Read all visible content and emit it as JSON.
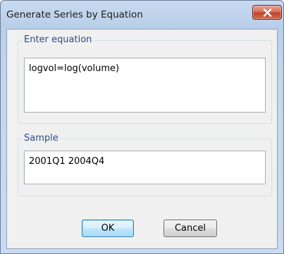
{
  "window": {
    "title": "Generate Series by Equation"
  },
  "equation_group": {
    "label": "Enter equation",
    "value": "logvol=log(volume)"
  },
  "sample_group": {
    "label": "Sample",
    "value": "2001Q1 2004Q4"
  },
  "buttons": {
    "ok_label": "OK",
    "cancel_label": "Cancel"
  },
  "icons": {
    "close": "close-icon"
  }
}
